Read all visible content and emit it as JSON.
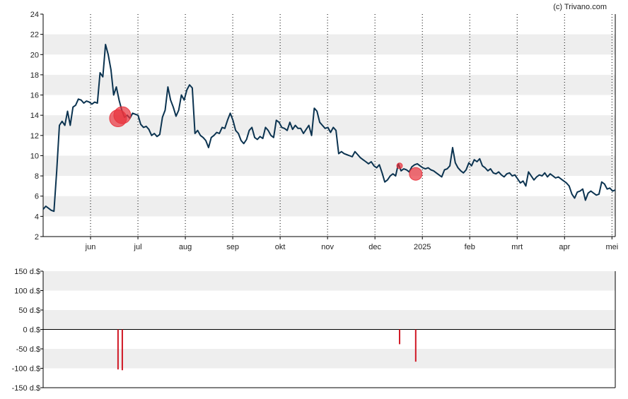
{
  "credit": "(c) Trivano.com",
  "colors": {
    "line": "#0b3350",
    "band": "#eeeeee",
    "marker_fill": "#e8323c",
    "bar": "#d01825",
    "axis": "#000000",
    "grid_vertical": "#000000"
  },
  "chart_data": [
    {
      "type": "line",
      "x_labels": [
        "jun",
        "jul",
        "aug",
        "sep",
        "okt",
        "nov",
        "dec",
        "2025",
        "feb",
        "mrt",
        "apr",
        "mei"
      ],
      "ylim": [
        2,
        24
      ],
      "y_ticks": [
        "2",
        "4",
        "6",
        "8",
        "10",
        "12",
        "14",
        "16",
        "18",
        "20",
        "22",
        "24"
      ],
      "grid": "alternating horizontal bands, dotted vertical lines at month starts",
      "series": [
        {
          "values": [
            4.7,
            5.0,
            4.8,
            4.6,
            4.5,
            8.5,
            13.0,
            13.4,
            13.0,
            14.4,
            13.0,
            14.8,
            15.0,
            15.6,
            15.5,
            15.2,
            15.4,
            15.3,
            15.1,
            15.3,
            15.2,
            18.2,
            17.8,
            21.0,
            20.0,
            18.5,
            16.0,
            16.8,
            15.5,
            14.5,
            13.8,
            14.0,
            13.7,
            14.2,
            14.1,
            14.0,
            13.1,
            12.8,
            12.9,
            12.6,
            12.0,
            12.2,
            11.9,
            12.1,
            13.8,
            14.5,
            16.8,
            15.5,
            14.8,
            13.9,
            14.5,
            16.0,
            15.5,
            16.5,
            17.0,
            16.7,
            12.2,
            12.5,
            12.0,
            11.8,
            11.5,
            10.8,
            11.8,
            12.0,
            12.3,
            12.2,
            12.8,
            12.7,
            13.5,
            14.2,
            13.5,
            12.5,
            12.2,
            11.5,
            11.2,
            11.6,
            12.5,
            12.8,
            11.8,
            11.6,
            11.9,
            11.7,
            12.8,
            12.5,
            12.0,
            11.8,
            13.5,
            13.3,
            12.8,
            12.7,
            12.5,
            13.3,
            12.6,
            13.0,
            12.7,
            12.7,
            12.2,
            12.6,
            13.0,
            12.0,
            14.7,
            14.4,
            13.3,
            13.0,
            12.7,
            12.8,
            12.3,
            12.8,
            12.5,
            10.2,
            10.4,
            10.2,
            10.1,
            10.0,
            9.9,
            10.4,
            10.1,
            9.8,
            9.6,
            9.4,
            9.2,
            9.4,
            9.0,
            8.8,
            9.1,
            8.3,
            7.4,
            7.6,
            8.0,
            8.2,
            8.0,
            9.2,
            8.5,
            8.7,
            8.6,
            8.4,
            8.9,
            9.1,
            9.2,
            9.0,
            8.8,
            8.7,
            8.8,
            8.6,
            8.5,
            8.3,
            8.1,
            7.9,
            8.6,
            8.7,
            9.0,
            10.8,
            9.3,
            8.8,
            8.5,
            8.3,
            8.6,
            9.3,
            9.0,
            9.6,
            9.4,
            9.7,
            9.0,
            8.8,
            8.5,
            8.7,
            8.3,
            8.2,
            8.4,
            8.1,
            7.9,
            8.2,
            8.3,
            8.0,
            8.1,
            7.7,
            7.3,
            7.5,
            7.0,
            8.4,
            8.0,
            7.6,
            7.9,
            8.1,
            8.0,
            8.3,
            7.9,
            8.2,
            8.0,
            7.8,
            7.9,
            7.7,
            7.5,
            7.3,
            7.0,
            6.2,
            5.8,
            6.4,
            6.5,
            6.7,
            5.6,
            6.3,
            6.5,
            6.3,
            6.1,
            6.2,
            7.4,
            7.2,
            6.7,
            6.8,
            6.5,
            6.6
          ],
          "x_first": 0.0,
          "x_last": 12.07
        }
      ],
      "x_scale_note": "x is measured in months since the start of May; month ticks at 1..12"
    },
    {
      "type": "bar",
      "ylim": [
        -150,
        150
      ],
      "y_ticks": [
        "150 d.$",
        "100 d.$",
        "50 d.$",
        "0 d.$",
        "-50 d.$",
        "-100 d.$",
        "-150 d.$"
      ],
      "grid": "alternating horizontal bands",
      "bars": [
        {
          "x": 1.58,
          "value": -103
        },
        {
          "x": 1.67,
          "value": -105
        },
        {
          "x": 7.52,
          "value": -38
        },
        {
          "x": 7.86,
          "value": -83
        }
      ]
    }
  ],
  "markers": [
    {
      "x": 1.58,
      "y": 13.7,
      "size": "large"
    },
    {
      "x": 1.67,
      "y": 14.0,
      "size": "large"
    },
    {
      "x": 7.52,
      "y": 9.0,
      "size": "small"
    },
    {
      "x": 7.86,
      "y": 8.2,
      "size": "medium"
    }
  ]
}
